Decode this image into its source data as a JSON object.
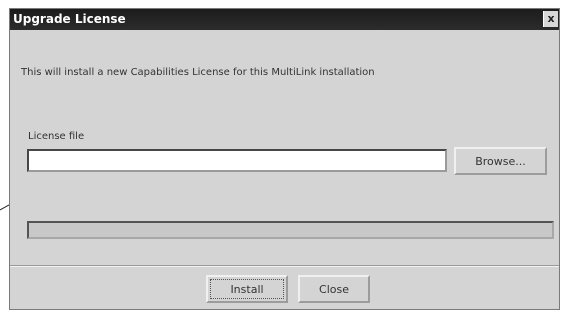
{
  "dialog": {
    "title": "Upgrade License",
    "close_glyph": "x",
    "message": "This will install a new Capabilities License for this MultiLink installation",
    "file_label": "License file",
    "file_value": "",
    "browse_label": "Browse...",
    "progress_fraction": 0,
    "install_label": "Install",
    "close_label": "Close"
  },
  "icons": {
    "close": "close-icon"
  }
}
